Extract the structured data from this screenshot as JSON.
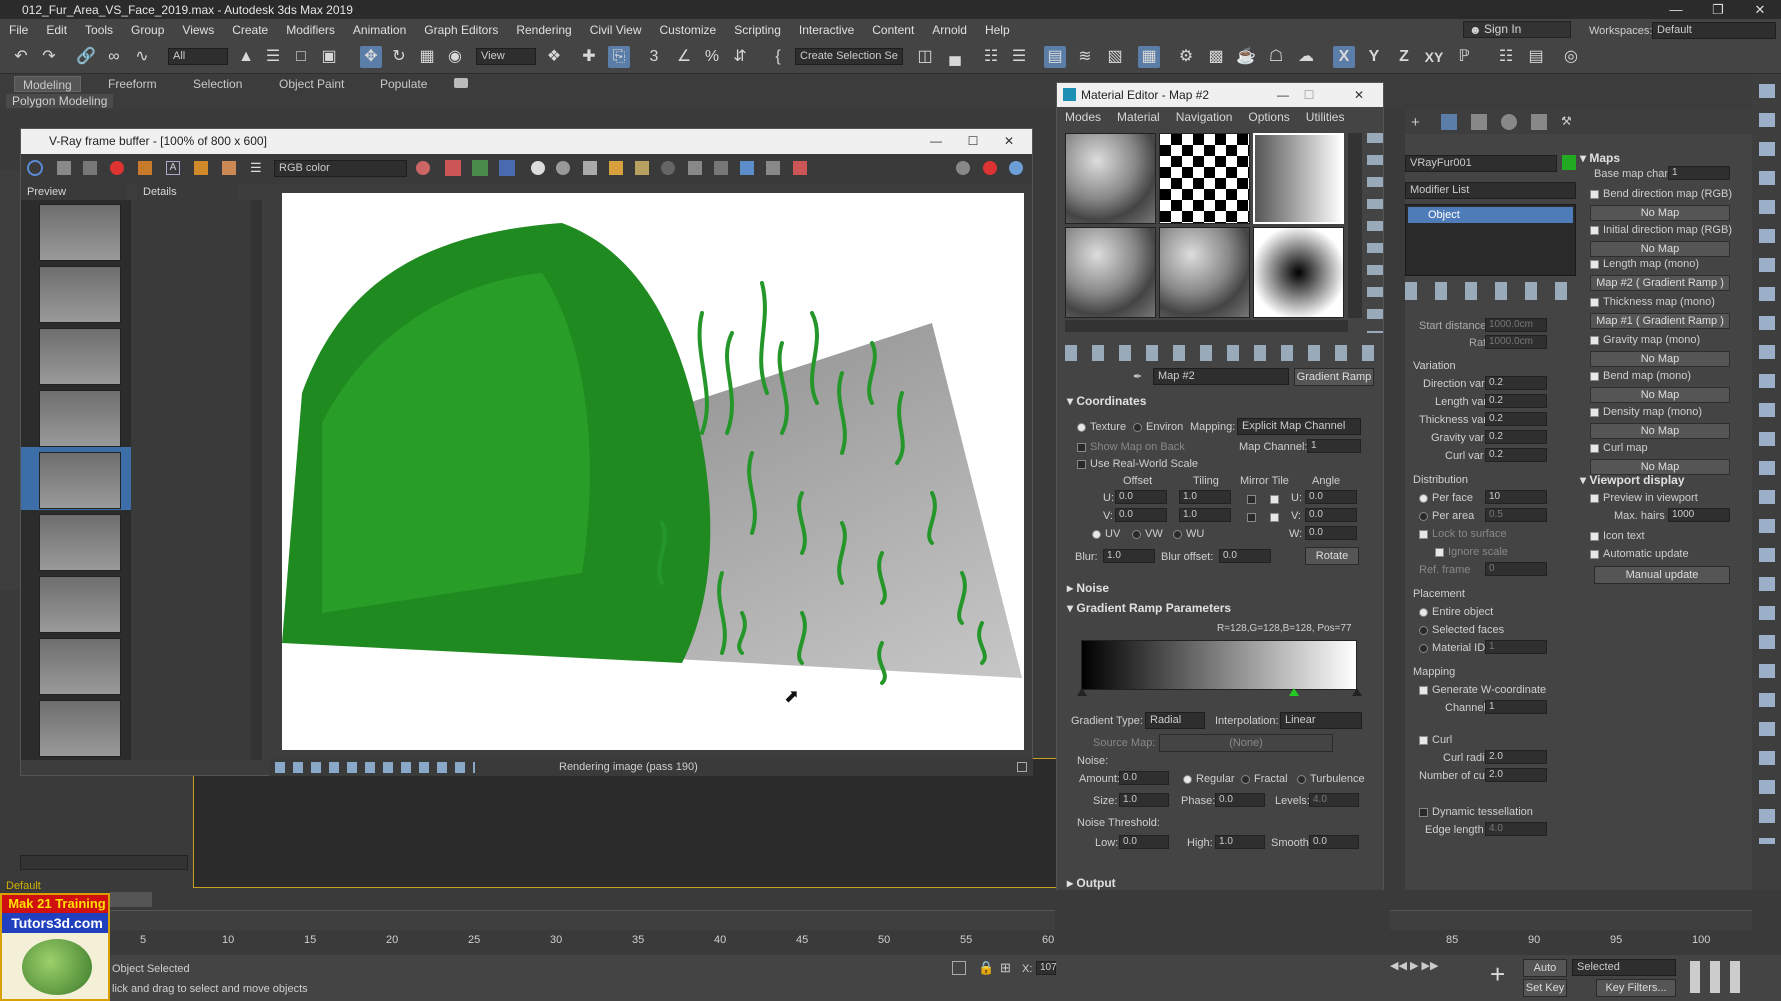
{
  "window": {
    "title": "012_Fur_Area_VS_Face_2019.max - Autodesk 3ds Max 2019"
  },
  "menu": [
    "File",
    "Edit",
    "Tools",
    "Group",
    "Views",
    "Create",
    "Modifiers",
    "Animation",
    "Graph Editors",
    "Rendering",
    "Civil View",
    "Customize",
    "Scripting",
    "Interactive",
    "Content",
    "Arnold",
    "Help"
  ],
  "account": {
    "sign_in": "Sign In",
    "workspaces_label": "Workspaces:",
    "workspace": "Default"
  },
  "toolbar": {
    "filter": "All",
    "view": "View",
    "selection_set": "Create Selection Se",
    "axis_x": "X",
    "axis_y": "Y",
    "axis_z": "Z",
    "axis_xy": "XY"
  },
  "ribbon": {
    "tabs": [
      "Modeling",
      "Freeform",
      "Selection",
      "Object Paint",
      "Populate"
    ],
    "sub": "Polygon Modeling"
  },
  "vfb": {
    "title": "V-Ray frame buffer - [100% of 800 x 600]",
    "channel": "RGB color",
    "col_preview": "Preview",
    "col_details": "Details",
    "status": "Rendering image (pass 190)"
  },
  "material_editor": {
    "title": "Material Editor - Map #2",
    "menu": [
      "Modes",
      "Material",
      "Navigation",
      "Options",
      "Utilities"
    ],
    "map_name": "Map #2",
    "map_type": "Gradient Ramp",
    "coordinates": {
      "title": "Coordinates",
      "texture": "Texture",
      "environ": "Environ",
      "mapping_label": "Mapping:",
      "mapping": "Explicit Map Channel",
      "show_map_on_back": "Show Map on Back",
      "map_channel_label": "Map Channel:",
      "map_channel": "1",
      "real_world": "Use Real-World Scale",
      "offset": "Offset",
      "tiling": "Tiling",
      "mirror_tile": "Mirror Tile",
      "angle": "Angle",
      "u": "U:",
      "v": "V:",
      "w": "W:",
      "u_offset": "0.0",
      "v_offset": "0.0",
      "u_tiling": "1.0",
      "v_tiling": "1.0",
      "u_angle": "0.0",
      "v_angle": "0.0",
      "w_angle": "0.0",
      "uv": "UV",
      "vw": "VW",
      "wu": "WU",
      "blur_label": "Blur:",
      "blur": "1.0",
      "blur_offset_label": "Blur offset:",
      "blur_offset": "0.0",
      "rotate": "Rotate"
    },
    "noise_section": "Noise",
    "gradient": {
      "title": "Gradient Ramp Parameters",
      "readout": "R=128,G=128,B=128, Pos=77",
      "type_label": "Gradient Type:",
      "type": "Radial",
      "interp_label": "Interpolation:",
      "interp": "Linear",
      "source_label": "Source Map:",
      "source": "(None)",
      "noise_label": "Noise:",
      "amount_label": "Amount:",
      "amount": "0.0",
      "regular": "Regular",
      "fractal": "Fractal",
      "turbulence": "Turbulence",
      "size_label": "Size:",
      "size": "1.0",
      "phase_label": "Phase:",
      "phase": "0.0",
      "levels_label": "Levels:",
      "levels": "4.0",
      "threshold_label": "Noise Threshold:",
      "low_label": "Low:",
      "low": "0.0",
      "high_label": "High:",
      "high": "1.0",
      "smooth_label": "Smooth:",
      "smooth": "0.0"
    },
    "output_section": "Output"
  },
  "command_panel": {
    "object_name": "VRayFur001",
    "modifier_list": "Modifier List",
    "stack_item": "Object",
    "start_distance_label": "Start distance",
    "start_distance": "1000.0cm",
    "rate_label": "Rate",
    "rate": "1000.0cm",
    "variation": "Variation",
    "direction_var_label": "Direction var",
    "direction_var": "0.2",
    "length_var_label": "Length var",
    "length_var": "0.2",
    "thickness_var_label": "Thickness var",
    "thickness_var": "0.2",
    "gravity_var_label": "Gravity var",
    "gravity_var": "0.2",
    "curl_var_label": "Curl var",
    "curl_var": "0.2",
    "distribution": "Distribution",
    "per_face_label": "Per face",
    "per_face": "10",
    "per_area_label": "Per area",
    "per_area": "0.5",
    "lock_surface": "Lock to surface",
    "ignore_scale": "Ignore scale",
    "ref_frame_label": "Ref. frame",
    "ref_frame": "0",
    "placement": "Placement",
    "entire_object": "Entire object",
    "selected_faces": "Selected faces",
    "material_id_label": "Material ID",
    "material_id": "1",
    "mapping": "Mapping",
    "gen_w": "Generate W-coordinate",
    "channel_label": "Channel",
    "channel": "1",
    "curl": "Curl",
    "curl_radius_label": "Curl radius",
    "curl_radius": "2.0",
    "num_curls_label": "Number of curls",
    "num_curls": "2.0",
    "dyn_tess": "Dynamic tessellation",
    "edge_length_label": "Edge length",
    "edge_length": "4.0"
  },
  "maps": {
    "title": "Maps",
    "base_chan_label": "Base map chan",
    "base_chan": "1",
    "items": [
      {
        "label": "Bend direction map (RGB)",
        "value": "No Map"
      },
      {
        "label": "Initial direction map (RGB)",
        "value": "No Map"
      },
      {
        "label": "Length map (mono)",
        "value": "Map #2 ( Gradient Ramp )"
      },
      {
        "label": "Thickness map (mono)",
        "value": "Map #1 ( Gradient Ramp )"
      },
      {
        "label": "Gravity map (mono)",
        "value": "No Map"
      },
      {
        "label": "Bend map (mono)",
        "value": "No Map"
      },
      {
        "label": "Density map (mono)",
        "value": "No Map"
      },
      {
        "label": "Curl map",
        "value": "No Map"
      }
    ],
    "viewport_display": "Viewport display",
    "preview_vp": "Preview in viewport",
    "max_hairs_label": "Max. hairs",
    "max_hairs": "1000",
    "icon_text": "Icon text",
    "auto_update": "Automatic update",
    "manual_update": "Manual update"
  },
  "viewport": {
    "layer": "Default"
  },
  "timeline": {
    "ticks": [
      "5",
      "10",
      "15",
      "20",
      "25",
      "30",
      "35",
      "40",
      "45",
      "50",
      "55",
      "60",
      "85",
      "90",
      "95",
      "100"
    ]
  },
  "status": {
    "selected": "Object Selected",
    "hint": "lick and drag to select and move objects",
    "x_label": "X:",
    "x_value": "107",
    "auto_key": "Auto Key",
    "set_key": "Set Key",
    "key_mode": "Selected",
    "key_filters": "Key Filters..."
  },
  "watermark": {
    "line1": "Mak 21 Training",
    "line2": "Tutors3d.com"
  }
}
